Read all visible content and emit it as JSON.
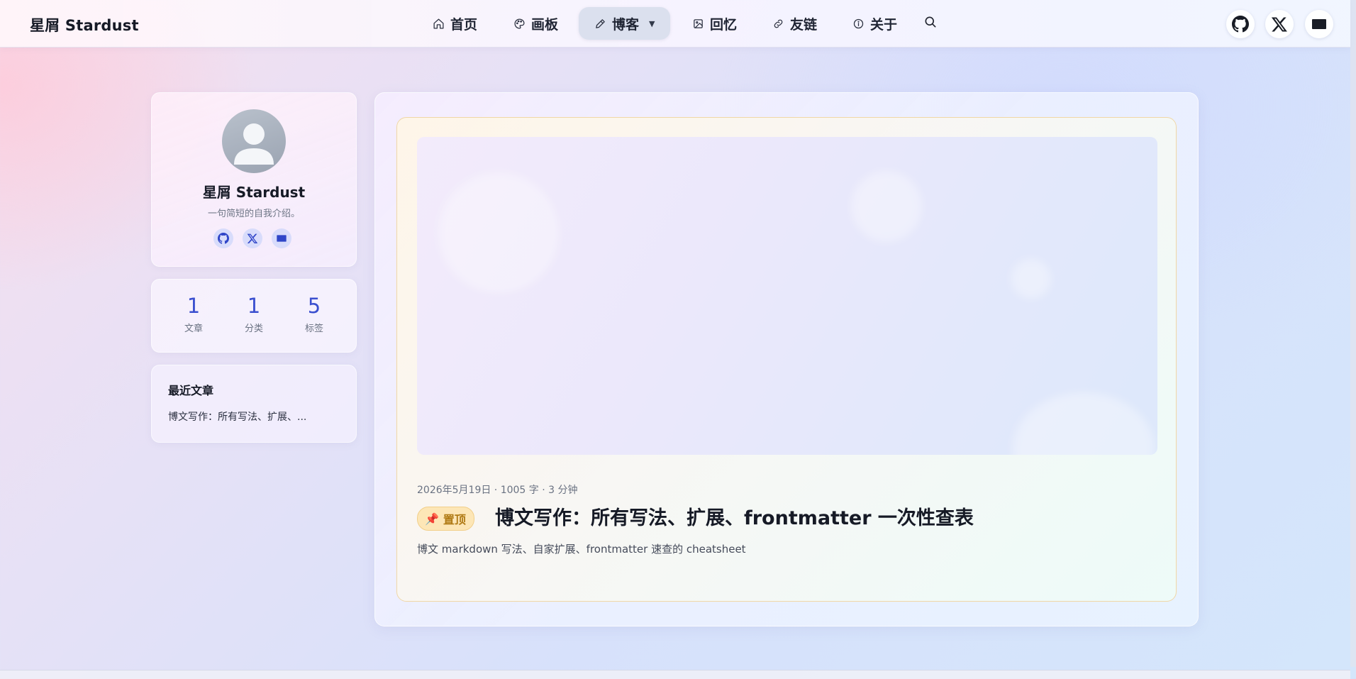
{
  "brand": "星屑 Stardust",
  "nav": {
    "items": [
      {
        "label": "首页",
        "icon": "home-icon"
      },
      {
        "label": "画板",
        "icon": "palette-icon"
      },
      {
        "label": "博客",
        "icon": "pencil-icon",
        "active": true
      },
      {
        "label": "回忆",
        "icon": "image-icon"
      },
      {
        "label": "友链",
        "icon": "link-icon"
      },
      {
        "label": "关于",
        "icon": "info-icon"
      }
    ],
    "search_icon": "search-icon"
  },
  "social": [
    "github-icon",
    "x-icon",
    "mail-icon"
  ],
  "profile": {
    "name": "星屑 Stardust",
    "bio": "一句简短的自我介绍。"
  },
  "stats": [
    {
      "value": "1",
      "label": "文章"
    },
    {
      "value": "1",
      "label": "分类"
    },
    {
      "value": "5",
      "label": "标签"
    }
  ],
  "recent": {
    "title": "最近文章",
    "items": [
      "博文写作：所有写法、扩展、..."
    ]
  },
  "post": {
    "meta": "2026年5月19日 · 1005 字 · 3 分钟",
    "pin_label": "置顶",
    "title": "博文写作：所有写法、扩展、frontmatter 一次性查表",
    "excerpt": "博文 markdown 写法、自家扩展、frontmatter 速查的 cheatsheet"
  },
  "colors": {
    "accent": "#3a4fcf",
    "pin_bg": "#fde6b6",
    "pin_text": "#b07a14",
    "post_border": "#f0d7a6"
  }
}
